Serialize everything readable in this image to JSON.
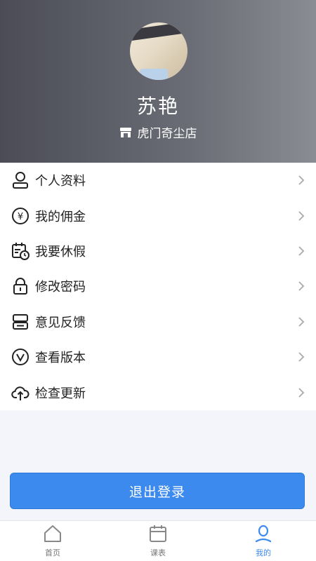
{
  "profile": {
    "name": "苏艳",
    "store": "虎门奇尘店"
  },
  "menu": {
    "items": [
      {
        "label": "个人资料",
        "icon": "user-icon"
      },
      {
        "label": "我的佣金",
        "icon": "yen-coin-icon"
      },
      {
        "label": "我要休假",
        "icon": "calendar-clock-icon"
      },
      {
        "label": "修改密码",
        "icon": "lock-icon"
      },
      {
        "label": "意见反馈",
        "icon": "feedback-icon"
      },
      {
        "label": "查看版本",
        "icon": "version-icon"
      },
      {
        "label": "检查更新",
        "icon": "cloud-upload-icon"
      }
    ]
  },
  "logout": {
    "label": "退出登录"
  },
  "tabbar": {
    "tabs": [
      {
        "label": "首页",
        "icon": "home-icon"
      },
      {
        "label": "课表",
        "icon": "calendar-icon"
      },
      {
        "label": "我的",
        "icon": "profile-icon",
        "active": true
      }
    ]
  },
  "colors": {
    "accent": "#3d8aef",
    "header": "#55565f"
  }
}
